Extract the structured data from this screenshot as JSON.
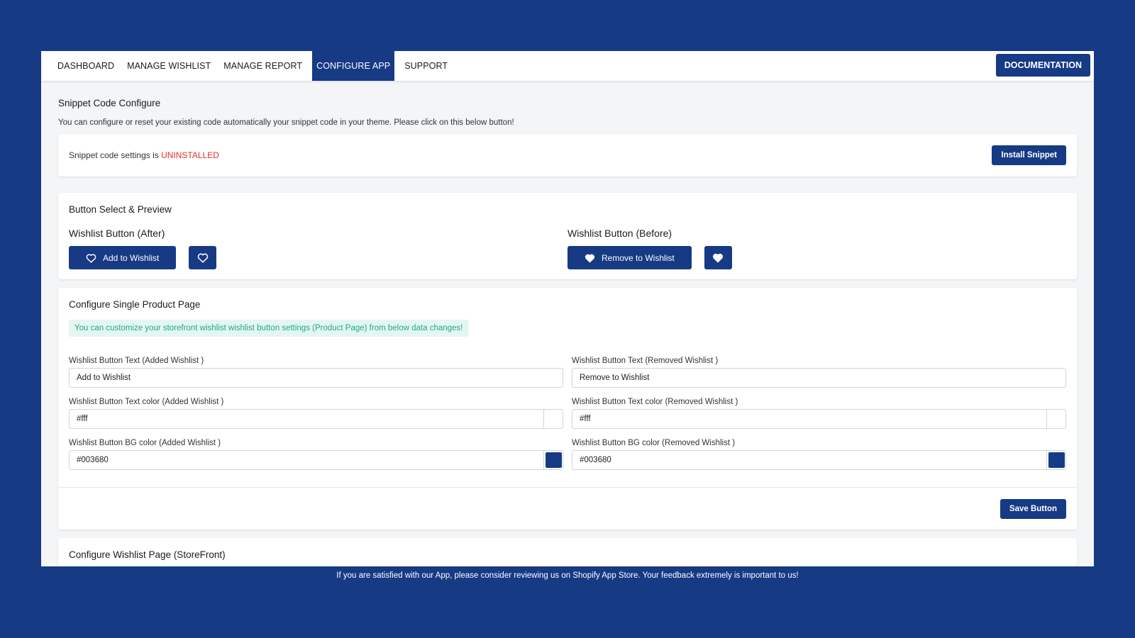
{
  "nav": {
    "tabs": [
      {
        "label": "DASHBOARD"
      },
      {
        "label": "MANAGE WISHLIST"
      },
      {
        "label": "MANAGE REPORT"
      },
      {
        "label": "CONFIGURE APP"
      },
      {
        "label": "SUPPORT"
      }
    ],
    "active_tab": "CONFIGURE APP",
    "documentation_label": "DOCUMENTATION"
  },
  "snippet": {
    "title": "Snippet Code Configure",
    "description": "You can configure or reset your existing code automatically your snippet code in your theme. Please click on this below button!",
    "status_prefix": "Snippet code settings is",
    "status_value": "UNINSTALLED",
    "install_label": "Install Snippet"
  },
  "preview": {
    "title": "Button Select & Preview",
    "after_title": "Wishlist Button (After)",
    "after_button_label": "Add to Wishlist",
    "before_title": "Wishlist Button (Before)",
    "before_button_label": "Remove to Wishlist",
    "after_icon": "heart-outline-icon",
    "before_icon": "heart-filled-icon"
  },
  "single_product": {
    "title": "Configure Single Product Page",
    "info": "You can customize your storefront wishlist wishlist button settings (Product Page) from below data changes!",
    "added_text_label": "Wishlist Button Text (Added Wishlist )",
    "added_text_value": "Add to Wishlist",
    "removed_text_label": "Wishlist Button Text (Removed Wishlist )",
    "removed_text_value": "Remove to Wishlist",
    "added_color_label": "Wishlist Button Text color (Added Wishlist )",
    "added_color_value": "#fff",
    "removed_color_label": "Wishlist Button Text color (Removed Wishlist )",
    "removed_color_value": "#fff",
    "added_bg_label": "Wishlist Button BG color (Added Wishlist )",
    "added_bg_value": "#003680",
    "removed_bg_label": "Wishlist Button BG color (Removed Wishlist )",
    "removed_bg_value": "#003680",
    "save_label": "Save Button"
  },
  "wishlist_page": {
    "title": "Configure Wishlist Page (StoreFront)"
  },
  "footer": {
    "note": "If you are satisfied with our App, please consider reviewing us on Shopify App Store. Your feedback extremely is important to us!"
  },
  "colors": {
    "brand": "#163a84",
    "page_bg": "#f4f5f7",
    "status_uninstalled": "#e0312b",
    "info_bg": "#e4f6f1",
    "info_text": "#1fa98a",
    "swatch_text_color": "#ffffff",
    "swatch_bg_color": "#163a84"
  }
}
